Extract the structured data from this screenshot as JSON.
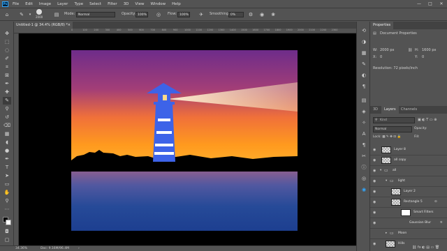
{
  "menubar": {
    "logo": "Ps",
    "items": [
      "File",
      "Edit",
      "Image",
      "Layer",
      "Type",
      "Select",
      "Filter",
      "3D",
      "View",
      "Window",
      "Help"
    ],
    "window_controls": [
      "—",
      "□",
      "✕"
    ]
  },
  "options": {
    "brush_size": "2000",
    "mode_label": "Mode:",
    "mode_value": "Normal",
    "opacity_label": "Opacity:",
    "opacity_value": "100%",
    "flow_label": "Flow:",
    "flow_value": "100%",
    "smoothing_label": "Smoothing:",
    "smoothing_value": "0%"
  },
  "document": {
    "tab_title": "Untitled-1 @ 34.4% (RGB/8) *",
    "tab_close": "×",
    "ruler_ticks": [
      "0",
      "100",
      "200",
      "300",
      "400",
      "500",
      "600",
      "700",
      "800",
      "900",
      "1000",
      "1100",
      "1200",
      "1300",
      "1400",
      "1500",
      "1600",
      "1700",
      "1800",
      "1900",
      "2000",
      "2100",
      "2200",
      "2300"
    ]
  },
  "status": {
    "zoom": "34.36%",
    "doc_info": "Doc: 9.16M/96.4M"
  },
  "properties": {
    "tab": "Properties",
    "title": "Document Properties",
    "w_label": "W:",
    "w_value": "2000 px",
    "h_label": "H:",
    "h_value": "1600 px",
    "x_label": "X:",
    "x_value": "0",
    "y_label": "Y:",
    "y_value": "0",
    "resolution": "Resolution: 72 pixels/inch"
  },
  "layers_panel": {
    "tabs": [
      "3D",
      "Layers",
      "Channels"
    ],
    "search_placeholder": "Kind",
    "blend_mode": "Normal",
    "opacity_label": "Opacity:",
    "fill_label": "Fill:",
    "rows": [
      {
        "name": "Layer 8"
      },
      {
        "name": "all copy"
      },
      {
        "name": "all"
      },
      {
        "name": "light"
      },
      {
        "name": "Layer 2"
      },
      {
        "name": "Rectangle 5"
      },
      {
        "name": "Smart Filters"
      },
      {
        "name": "Gaussian Blur"
      },
      {
        "name": "Moon"
      },
      {
        "name": "Hills"
      }
    ]
  },
  "colors": {
    "sky_top": "#7a2a86",
    "sky_bottom": "#ff9a1e",
    "water_top": "#5b5ea6",
    "water_bottom": "#1f3f8f",
    "lighthouse": "#3d63e8",
    "canvas_bg": "#000000",
    "ui_bg": "#535353"
  }
}
